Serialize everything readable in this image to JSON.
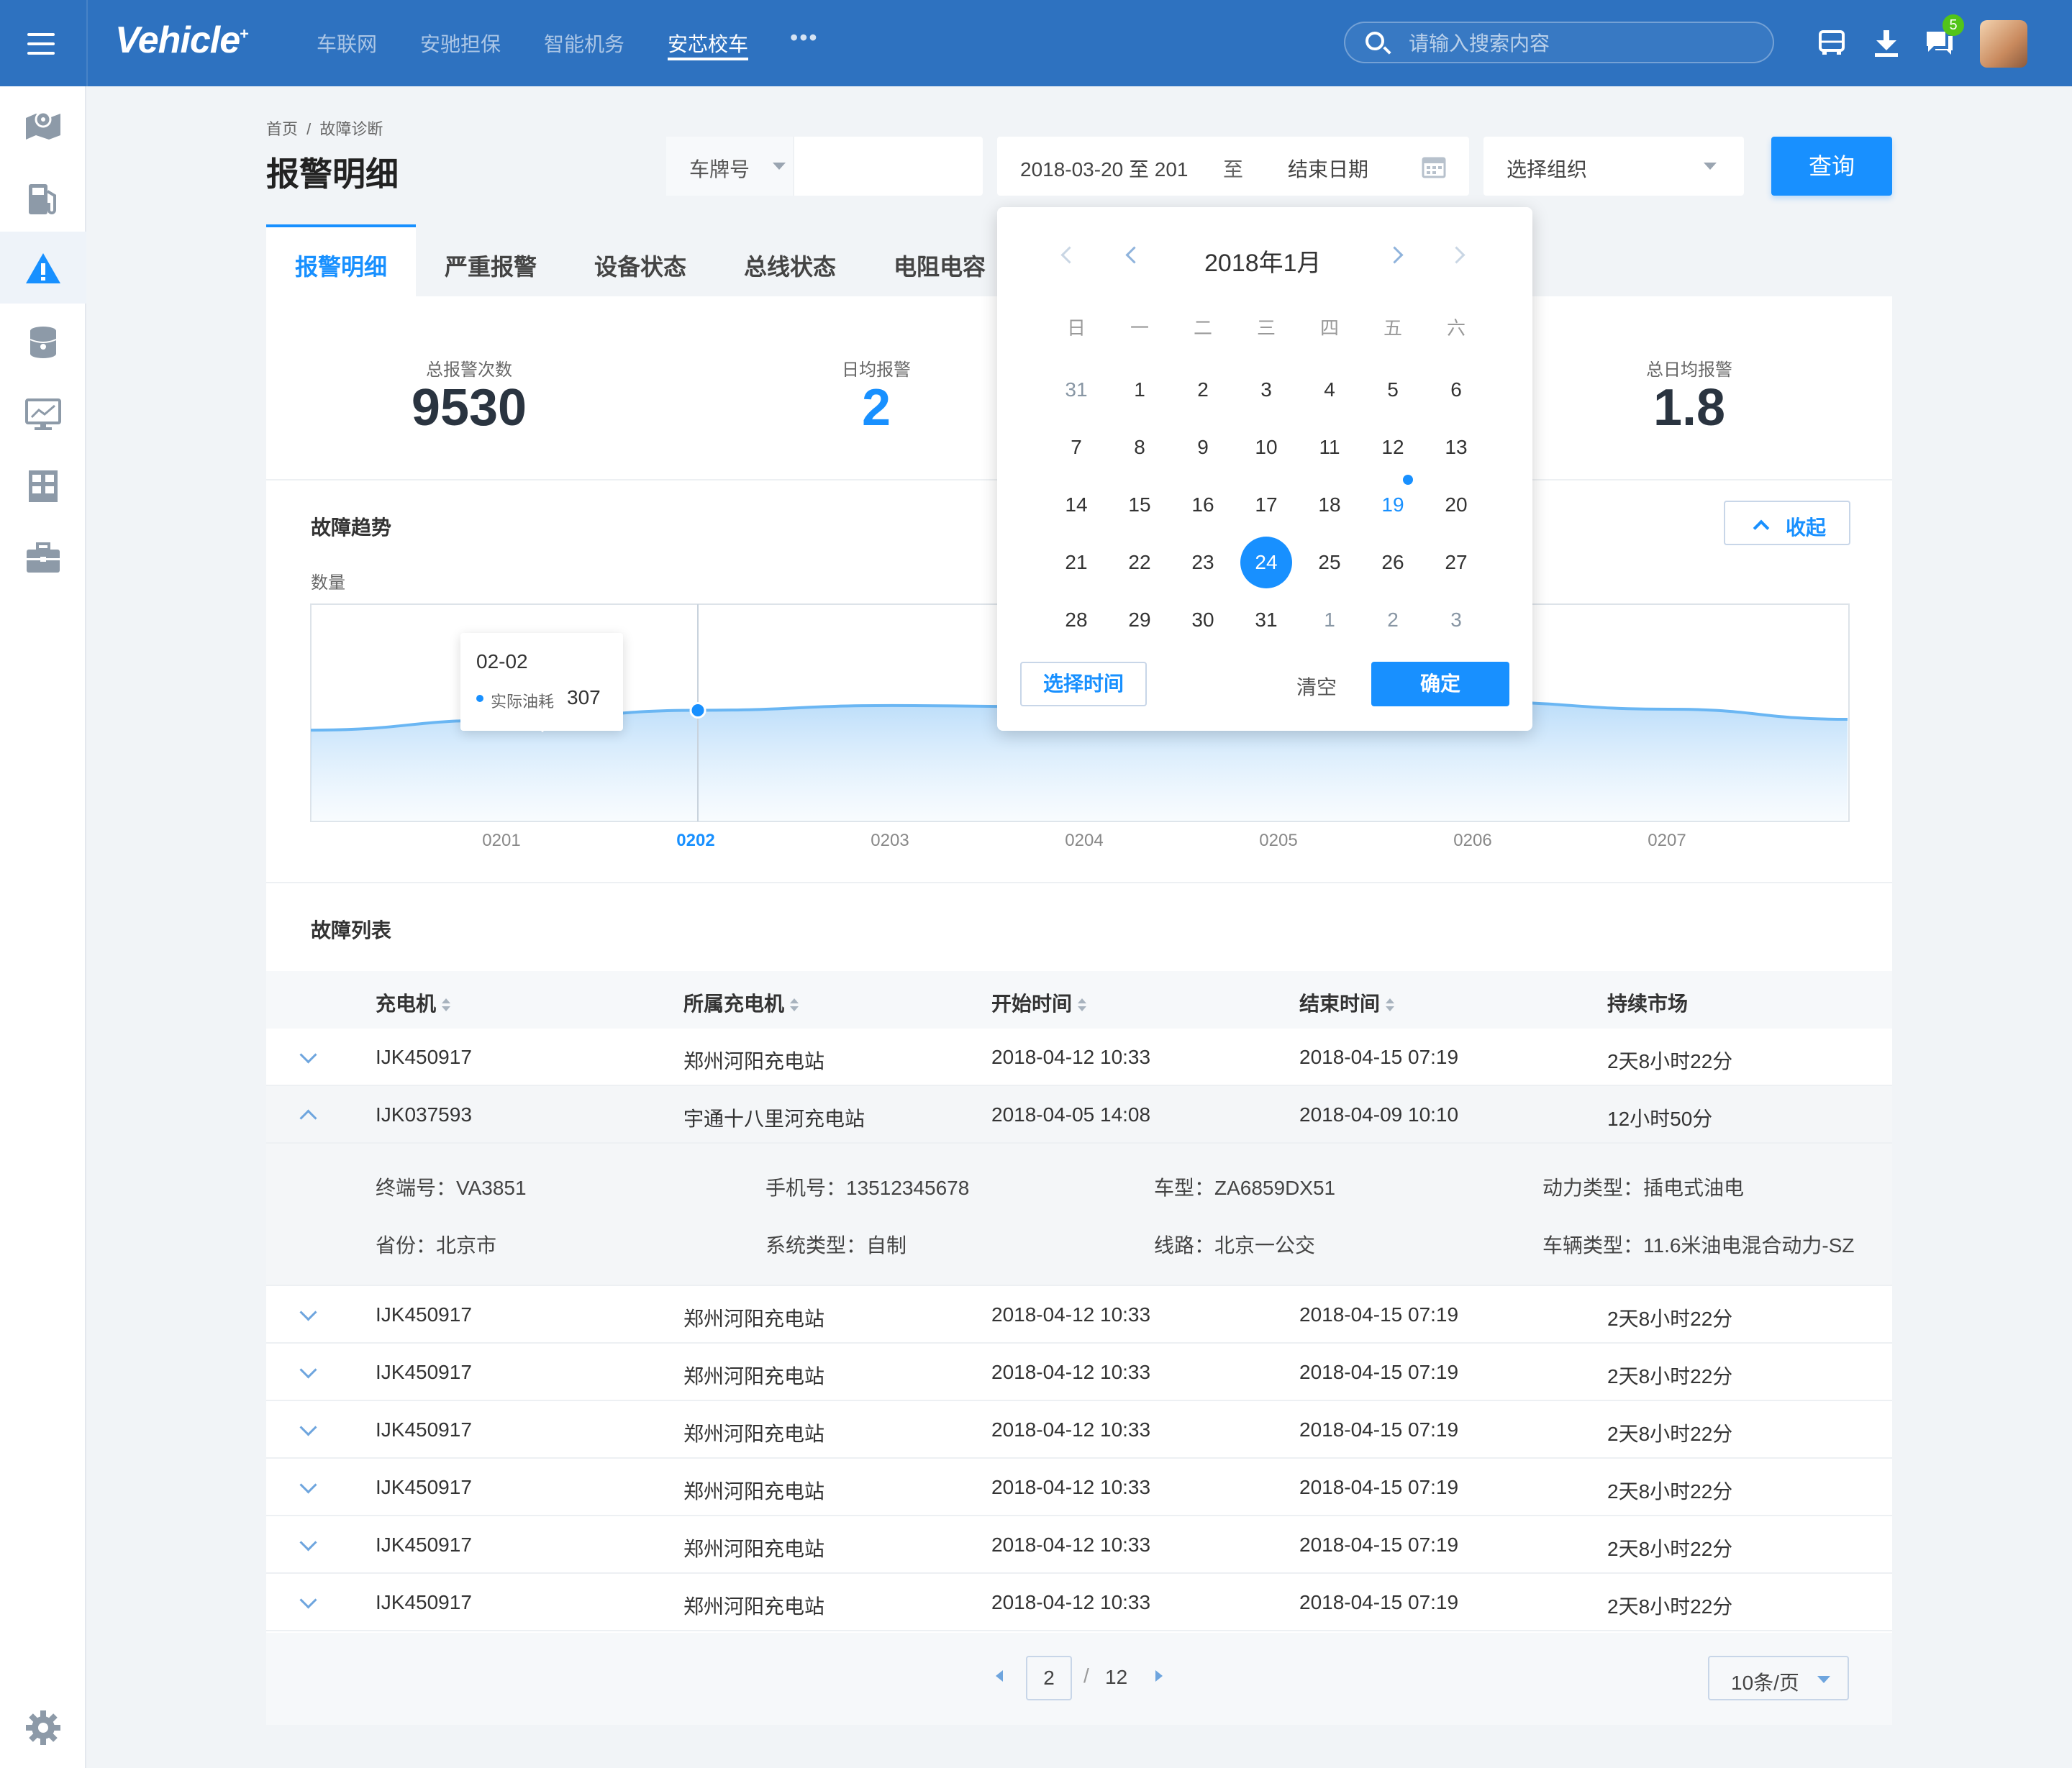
{
  "app": {
    "logo": "Vehicle",
    "logo_mark": "+"
  },
  "nav": {
    "items": [
      "车联网",
      "安驰担保",
      "智能机务",
      "安芯校车"
    ],
    "active": "安芯校车",
    "more": "•••"
  },
  "search": {
    "placeholder": "请输入搜索内容"
  },
  "notifications": {
    "badge": "5"
  },
  "sidebar": {
    "items": [
      "map-pin-icon",
      "fuel-station-icon",
      "alert-icon",
      "database-icon",
      "monitor-chart-icon",
      "grid-icon",
      "briefcase-icon"
    ],
    "active": "alert-icon",
    "footer": "settings-gear-icon"
  },
  "header": {
    "breadcrumb": [
      "首页",
      "故障诊断"
    ],
    "breadcrumb_sep": "/",
    "title": "报警明细"
  },
  "filters": {
    "plate_label": "车牌号",
    "date_start": "2018-03-20 至 201",
    "date_sep": "至",
    "date_end_placeholder": "结束日期",
    "org_placeholder": "选择组织",
    "query_button": "查询"
  },
  "tabs": [
    "报警明细",
    "严重报警",
    "设备状态",
    "总线状态",
    "电阻电容"
  ],
  "stats": [
    {
      "label": "总报警次数",
      "value": "9530"
    },
    {
      "label": "日均报警",
      "value": "2"
    },
    {
      "label": "总日均报警",
      "value": "1.8"
    }
  ],
  "trend": {
    "title": "故障趋势",
    "collapse_label": "收起"
  },
  "chart_data": {
    "type": "area",
    "ylabel": "数量",
    "categories": [
      "0201",
      "0202",
      "0203",
      "0204",
      "0205",
      "0206",
      "0207"
    ],
    "highlighted_category": "0202",
    "series": [
      {
        "name": "实际油耗",
        "values": [
          280,
          307,
          320,
          316,
          345,
          330,
          310
        ]
      }
    ],
    "tooltip": {
      "date": "02-02",
      "series": "实际油耗",
      "value": "307"
    }
  },
  "list": {
    "title": "故障列表",
    "columns": [
      "充电机",
      "所属充电机",
      "开始时间",
      "结束时间",
      "持续市场"
    ],
    "rows": [
      [
        "IJK450917",
        "郑州河阳充电站",
        "2018-04-12 10:33",
        "2018-04-15 07:19",
        "2天8小时22分"
      ],
      [
        "IJK037593",
        "宇通十八里河充电站",
        "2018-04-05 14:08",
        "2018-04-09 10:10",
        "12小时50分"
      ],
      [
        "IJK450917",
        "郑州河阳充电站",
        "2018-04-12 10:33",
        "2018-04-15 07:19",
        "2天8小时22分"
      ],
      [
        "IJK450917",
        "郑州河阳充电站",
        "2018-04-12 10:33",
        "2018-04-15 07:19",
        "2天8小时22分"
      ],
      [
        "IJK450917",
        "郑州河阳充电站",
        "2018-04-12 10:33",
        "2018-04-15 07:19",
        "2天8小时22分"
      ],
      [
        "IJK450917",
        "郑州河阳充电站",
        "2018-04-12 10:33",
        "2018-04-15 07:19",
        "2天8小时22分"
      ],
      [
        "IJK450917",
        "郑州河阳充电站",
        "2018-04-12 10:33",
        "2018-04-15 07:19",
        "2天8小时22分"
      ],
      [
        "IJK450917",
        "郑州河阳充电站",
        "2018-04-12 10:33",
        "2018-04-15 07:19",
        "2天8小时22分"
      ]
    ],
    "expanded_row": 1,
    "detail": [
      [
        "终端号：VA3851",
        "手机号：13512345678",
        "车型：ZA6859DX51",
        "动力类型：插电式油电"
      ],
      [
        "省份：北京市",
        "系统类型：自制",
        "线路：北京一公交",
        "车辆类型：11.6米油电混合动力-SZ"
      ]
    ]
  },
  "pagination": {
    "current": "2",
    "sep": "/",
    "total": "12",
    "page_size": "10条/页"
  },
  "calendar": {
    "title": "2018年1月",
    "weekdays": [
      "日",
      "一",
      "二",
      "三",
      "四",
      "五",
      "六"
    ],
    "weeks": [
      [
        "31",
        "1",
        "2",
        "3",
        "4",
        "5",
        "6"
      ],
      [
        "7",
        "8",
        "9",
        "10",
        "11",
        "12",
        "13"
      ],
      [
        "14",
        "15",
        "16",
        "17",
        "18",
        "19",
        "20"
      ],
      [
        "21",
        "22",
        "23",
        "24",
        "25",
        "26",
        "27"
      ],
      [
        "28",
        "29",
        "30",
        "31",
        "1",
        "2",
        "3"
      ]
    ],
    "today": "19",
    "selected": "24",
    "select_time": "选择时间",
    "clear": "清空",
    "confirm": "确定"
  },
  "colors": {
    "primary": "#1890FF",
    "topbar": "#2E72C0",
    "badge": "#52C41A"
  }
}
